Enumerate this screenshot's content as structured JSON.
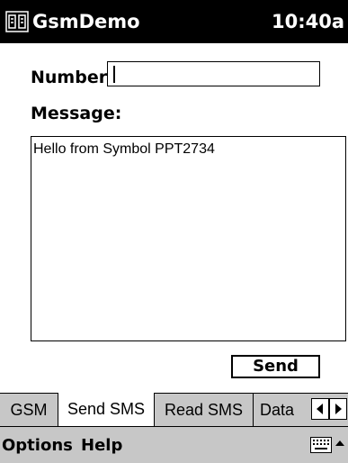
{
  "titlebar": {
    "title": "GsmDemo",
    "time": "10:40a",
    "app_icon": "app-icon"
  },
  "form": {
    "number_label": "Number:",
    "number_value": "",
    "message_label": "Message:",
    "message_text": "Hello from Symbol PPT2734",
    "send_label": "Send"
  },
  "tabs": {
    "items": [
      "GSM",
      "Send SMS",
      "Read SMS",
      "Data"
    ],
    "active": "Send SMS",
    "scroll_left_icon": "triangle-left-icon",
    "scroll_right_icon": "triangle-right-icon"
  },
  "menubar": {
    "options": "Options",
    "help": "Help",
    "keyboard_icon": "keyboard-icon",
    "sip_arrow_icon": "triangle-up-icon"
  },
  "colors": {
    "titlebar_bg": "#000000",
    "bar_bg": "#c7c7c7",
    "page_bg": "#ffffff"
  }
}
